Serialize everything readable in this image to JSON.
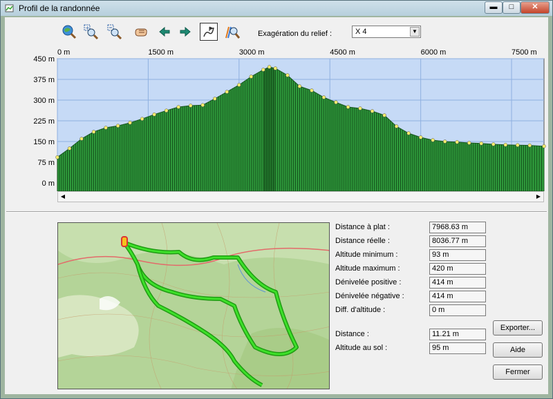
{
  "window": {
    "title": "Profil de la randonnée"
  },
  "titlebar_buttons": {
    "minimize": "▬",
    "maximize": "□",
    "close": "✕"
  },
  "toolbar": {
    "relief_label": "Exagération du relief :",
    "relief_value": "X 4"
  },
  "chart_data": {
    "type": "area",
    "x_unit": "m",
    "y_unit": "m",
    "x_ticks": [
      "0 m",
      "1500 m",
      "3000 m",
      "4500 m",
      "6000 m",
      "7500 m"
    ],
    "x_tick_values": [
      0,
      1500,
      3000,
      4500,
      6000,
      7500
    ],
    "y_ticks": [
      "450 m",
      "375 m",
      "300 m",
      "225 m",
      "150 m",
      "75 m",
      "0 m"
    ],
    "y_tick_values": [
      450,
      375,
      300,
      225,
      150,
      75,
      0
    ],
    "xlim": [
      0,
      8036
    ],
    "ylim": [
      -30,
      450
    ],
    "grid": true,
    "x": [
      0,
      200,
      400,
      600,
      800,
      1000,
      1200,
      1400,
      1600,
      1800,
      2000,
      2200,
      2400,
      2600,
      2800,
      3000,
      3200,
      3400,
      3500,
      3600,
      3800,
      4000,
      4200,
      4400,
      4600,
      4800,
      5000,
      5200,
      5400,
      5600,
      5800,
      6000,
      6200,
      6400,
      6600,
      6800,
      7000,
      7200,
      7400,
      7600,
      7800,
      8036
    ],
    "y": [
      93,
      125,
      160,
      185,
      200,
      207,
      218,
      232,
      248,
      262,
      275,
      280,
      282,
      305,
      330,
      355,
      385,
      410,
      420,
      415,
      390,
      350,
      335,
      310,
      292,
      275,
      270,
      260,
      245,
      205,
      180,
      165,
      155,
      150,
      148,
      145,
      143,
      140,
      138,
      137,
      136,
      133
    ]
  },
  "stats": [
    {
      "label": "Distance à plat :",
      "value": "7968.63 m"
    },
    {
      "label": "Distance réelle :",
      "value": "8036.77 m"
    },
    {
      "label": "Altitude minimum :",
      "value": "93 m"
    },
    {
      "label": "Altitude maximum :",
      "value": "420 m"
    },
    {
      "label": "Dénivelée positive :",
      "value": "414 m"
    },
    {
      "label": "Dénivelée négative :",
      "value": "414 m"
    },
    {
      "label": "Diff. d'altitude :",
      "value": "0 m"
    }
  ],
  "cursor": [
    {
      "label": "Distance :",
      "value": "11.21 m"
    },
    {
      "label": "Altitude au sol :",
      "value": "95 m"
    }
  ],
  "buttons": {
    "export": "Exporter...",
    "help": "Aide",
    "close": "Fermer"
  },
  "colors": {
    "plot_bg": "#c6daf6",
    "profile_fill": "#2f9b3c",
    "route": "#27d01b",
    "marker": "#f5ec6c"
  }
}
